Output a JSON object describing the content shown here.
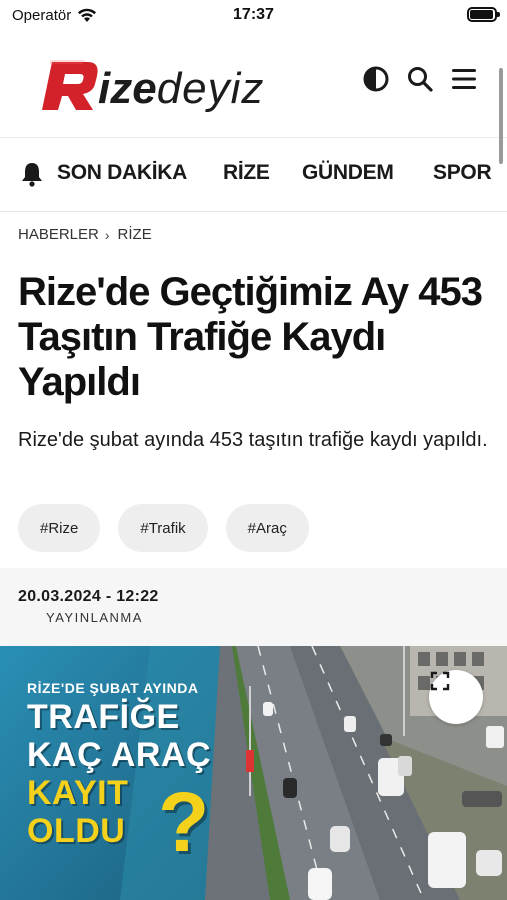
{
  "status_bar": {
    "carrier": "Operatör",
    "time": "17:37",
    "battery_level": 0.95
  },
  "header": {
    "logo_text_bold": "ize",
    "logo_text_light": "deyiz",
    "logo_letter": "R",
    "brand_color": "#d3222a",
    "icons": [
      "contrast-icon",
      "search-icon",
      "menu-icon"
    ]
  },
  "nav": {
    "items": [
      "SON DAKİKA",
      "RİZE",
      "GÜNDEM",
      "SPOR"
    ],
    "bell_icon": "bell-icon"
  },
  "breadcrumb": {
    "items": [
      "HABERLER",
      "RİZE"
    ]
  },
  "article": {
    "title": "Rize'de Geçtiğimiz Ay 453 Taşıtın Trafiğe Kaydı Yapıldı",
    "summary": "Rize'de şubat ayında 453 taşıtın trafiğe kaydı yapıldı.",
    "tags": [
      "#Rize",
      "#Trafik",
      "#Araç"
    ],
    "date": "20.03.2024 - 12:22",
    "date_label": "YAYINLANMA"
  },
  "hero": {
    "subtitle": "RİZE'DE ŞUBAT AYINDA",
    "line1": "TRAFİĞE",
    "line2": "KAÇ ARAÇ",
    "line3": "KAYIT",
    "line4": "OLDU",
    "question_mark": "?",
    "expand_icon": "expand-icon"
  }
}
